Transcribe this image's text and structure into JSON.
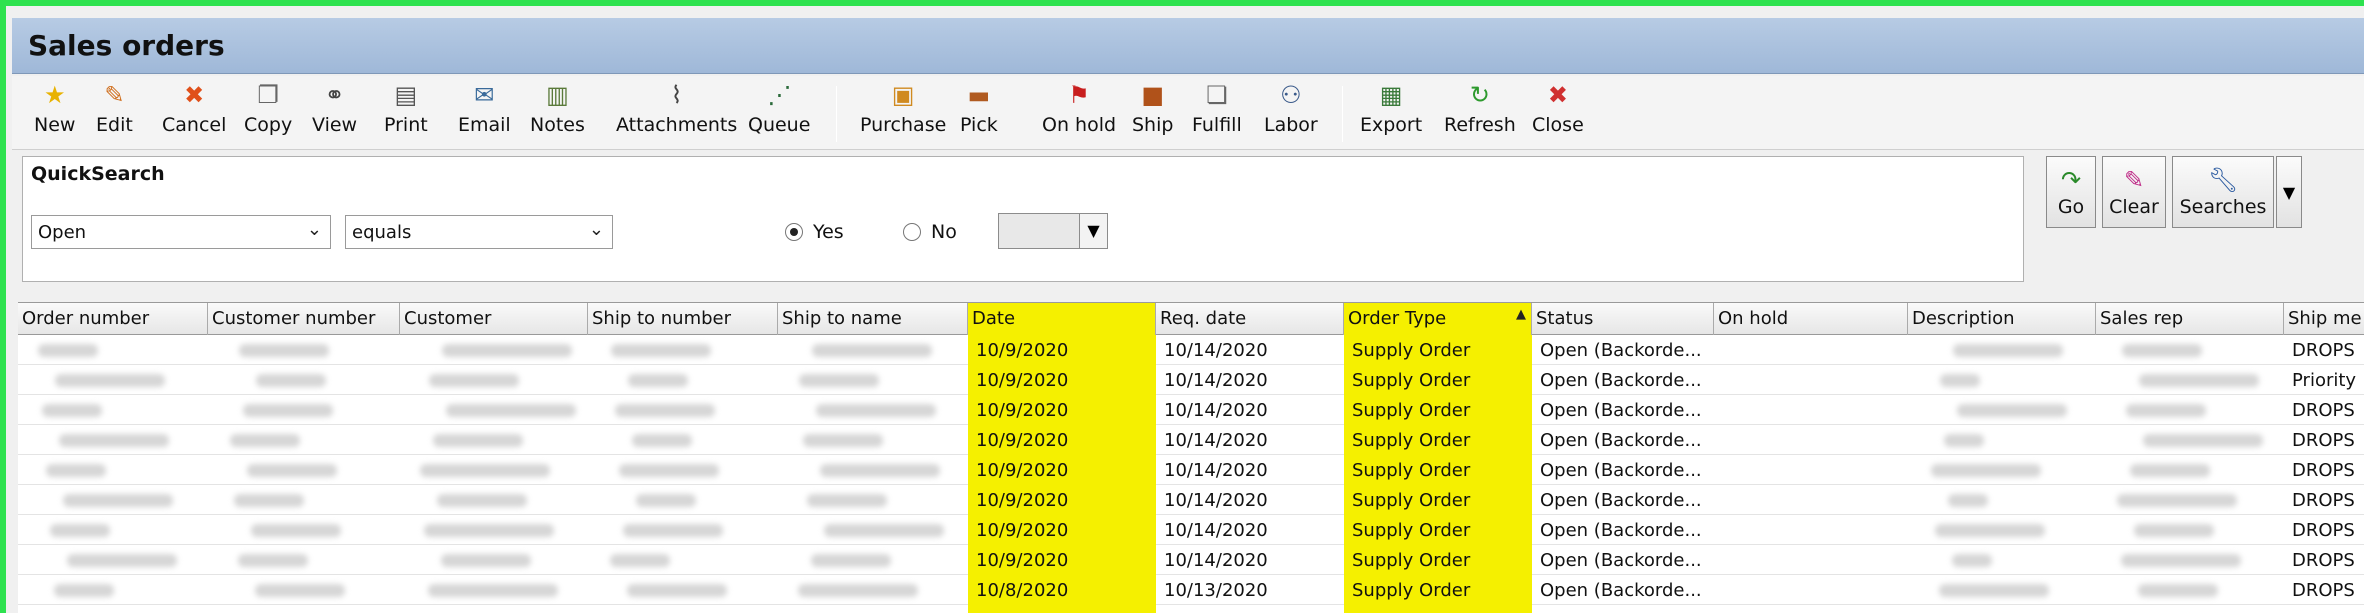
{
  "window": {
    "title": "Sales orders"
  },
  "toolbar": {
    "buttons": [
      {
        "label": "New",
        "icon": "star-icon",
        "glyph": "★",
        "color": "#e8b200"
      },
      {
        "label": "Edit",
        "icon": "pencil-icon",
        "glyph": "✎",
        "color": "#d07020"
      },
      {
        "label": "Cancel",
        "icon": "cancel-x-icon",
        "glyph": "✖",
        "color": "#e0501a"
      },
      {
        "label": "Copy",
        "icon": "copy-icon",
        "glyph": "❐",
        "color": "#666666"
      },
      {
        "label": "View",
        "icon": "binoculars-icon",
        "glyph": "⚭",
        "color": "#444444"
      },
      {
        "label": "Print",
        "icon": "printer-icon",
        "glyph": "▤",
        "color": "#555555"
      },
      {
        "label": "Email",
        "icon": "email-icon",
        "glyph": "✉",
        "color": "#3a6a9a"
      },
      {
        "label": "Notes",
        "icon": "notes-icon",
        "glyph": "▥",
        "color": "#5a7a3a"
      },
      {
        "label": "Attachments",
        "icon": "paperclip-icon",
        "glyph": "⌇",
        "color": "#444444"
      },
      {
        "label": "Queue",
        "icon": "queue-icon",
        "glyph": "⋰",
        "color": "#2a6a3a"
      },
      {
        "label": "Purchase",
        "icon": "purchase-icon",
        "glyph": "▣",
        "color": "#d08a20"
      },
      {
        "label": "Pick",
        "icon": "pick-icon",
        "glyph": "▬",
        "color": "#b05a20"
      },
      {
        "label": "On hold",
        "icon": "flag-icon",
        "glyph": "⚑",
        "color": "#c81e1e"
      },
      {
        "label": "Ship",
        "icon": "ship-box-icon",
        "glyph": "■",
        "color": "#b0521a"
      },
      {
        "label": "Fulfill",
        "icon": "fulfill-icon",
        "glyph": "❏",
        "color": "#666666"
      },
      {
        "label": "Labor",
        "icon": "labor-icon",
        "glyph": "⚇",
        "color": "#3a5a8a"
      },
      {
        "label": "Export",
        "icon": "export-icon",
        "glyph": "▦",
        "color": "#3a7a3a"
      },
      {
        "label": "Refresh",
        "icon": "refresh-icon",
        "glyph": "↻",
        "color": "#2e9a2e"
      },
      {
        "label": "Close",
        "icon": "close-icon",
        "glyph": "✖",
        "color": "#d03030"
      }
    ]
  },
  "quicksearch": {
    "title": "QuickSearch",
    "field": "Open",
    "operator": "equals",
    "radio_yes": "Yes",
    "radio_no": "No",
    "selected": "Yes",
    "go_label": "Go",
    "clear_label": "Clear",
    "searches_label": "Searches"
  },
  "grid": {
    "columns": [
      "Order number",
      "Customer number",
      "Customer",
      "Ship to number",
      "Ship to name",
      "Date",
      "Req. date",
      "Order Type",
      "Status",
      "On hold",
      "Description",
      "Sales rep",
      "Ship me"
    ],
    "highlight_color": "#f5f000",
    "rows": [
      {
        "date": "10/9/2020",
        "req_date": "10/14/2020",
        "order_type": "Supply Order",
        "status": "Open (Backorde...",
        "ship": "DROPS"
      },
      {
        "date": "10/9/2020",
        "req_date": "10/14/2020",
        "order_type": "Supply Order",
        "status": "Open (Backorde...",
        "ship": "Priority"
      },
      {
        "date": "10/9/2020",
        "req_date": "10/14/2020",
        "order_type": "Supply Order",
        "status": "Open (Backorde...",
        "ship": "DROPS"
      },
      {
        "date": "10/9/2020",
        "req_date": "10/14/2020",
        "order_type": "Supply Order",
        "status": "Open (Backorde...",
        "ship": "DROPS"
      },
      {
        "date": "10/9/2020",
        "req_date": "10/14/2020",
        "order_type": "Supply Order",
        "status": "Open (Backorde...",
        "ship": "DROPS"
      },
      {
        "date": "10/9/2020",
        "req_date": "10/14/2020",
        "order_type": "Supply Order",
        "status": "Open (Backorde...",
        "ship": "DROPS"
      },
      {
        "date": "10/9/2020",
        "req_date": "10/14/2020",
        "order_type": "Supply Order",
        "status": "Open (Backorde...",
        "ship": "DROPS"
      },
      {
        "date": "10/9/2020",
        "req_date": "10/14/2020",
        "order_type": "Supply Order",
        "status": "Open (Backorde...",
        "ship": "DROPS"
      },
      {
        "date": "10/8/2020",
        "req_date": "10/13/2020",
        "order_type": "Supply Order",
        "status": "Open (Backorde...",
        "ship": "DROPS"
      }
    ]
  }
}
